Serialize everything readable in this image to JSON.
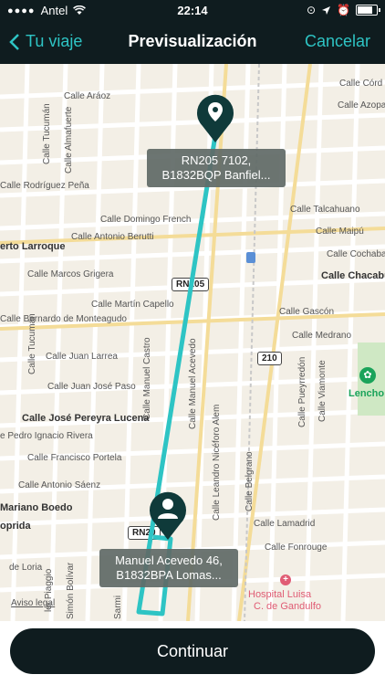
{
  "status_bar": {
    "carrier": "Antel",
    "time": "22:14"
  },
  "nav": {
    "back_label": "Tu viaje",
    "title": "Previsualización",
    "cancel_label": "Cancelar"
  },
  "map": {
    "origin_label_line1": "RN205 7102,",
    "origin_label_line2": "B1832BQP Banfiel...",
    "destination_label_line1": "Manuel Acevedo 46,",
    "destination_label_line2": "B1832BPA Lomas...",
    "legal_link": "Aviso legal",
    "route_color": "#2ec4c4",
    "pin_color": "#0f3a3a",
    "streets": {
      "arroz": "Calle Aráoz",
      "cordoba": "Calle Córd",
      "azopardo": "Calle Azopa",
      "tucuman_top": "Calle Tucumán",
      "almafuerte": "Calle Almafuerte",
      "rodriguez_pena": "Calle Rodríguez Peña",
      "domingo_french": "Calle Domingo French",
      "talcahuano": "Calle Talcahuano",
      "antonio_berutti": "Calle Antonio Berutti",
      "maipu": "Calle Maipú",
      "larroque": "erto Larroque",
      "cochabamba": "Calle Cochaban",
      "marcos_grigera": "Calle Marcos Grigera",
      "chacabuco": "Calle Chacabu",
      "martin_capello": "Calle Martín Capello",
      "gascon": "Calle Gascón",
      "bernardo": "Calle Bernardo de Monteagudo",
      "medrano": "Calle Medrano",
      "tucuman_mid": "Calle Tucumán",
      "juan_larrea": "Calle Juan Larrea",
      "juan_jose_paso": "Calle Juan José Paso",
      "manuel_castro": "Calle Manuel Castro",
      "manuel_acevedo": "Calle Manuel Acevedo",
      "pueyrredon": "Calle Pueyrredón",
      "viamonte": "Calle Viamonte",
      "jose_pereyra": "Calle José Pereyra Lucena",
      "leandro_alem": "Calle Leandro Nicéforo Alem",
      "pedro_rivera": "e Pedro Ignacio Rivera",
      "francisco_portela": "Calle Francisco Portela",
      "belgrano": "Calle Belgrano",
      "antonio_saenz": "Calle Antonio Sáenz",
      "mariano_boedo": "Mariano Boedo",
      "lamadrid": "Calle Lamadrid",
      "oprida": "oprida",
      "fonrouge": "Calle Fonrouge",
      "de_loria": "de Loria",
      "piaggio": "ler Piaggio",
      "simon_bolivar": "Simón Bolívar",
      "sarmiento": "Sarmi"
    },
    "route_shields": {
      "rn205_mid": "RN205",
      "route_210": "210",
      "rn205_bottom": "RN20"
    },
    "poi": {
      "lencho": "Lencho",
      "hospital_line1": "Hospital Luisa",
      "hospital_line2": "C. de Gandulfo"
    }
  },
  "continue_label": "Continuar"
}
